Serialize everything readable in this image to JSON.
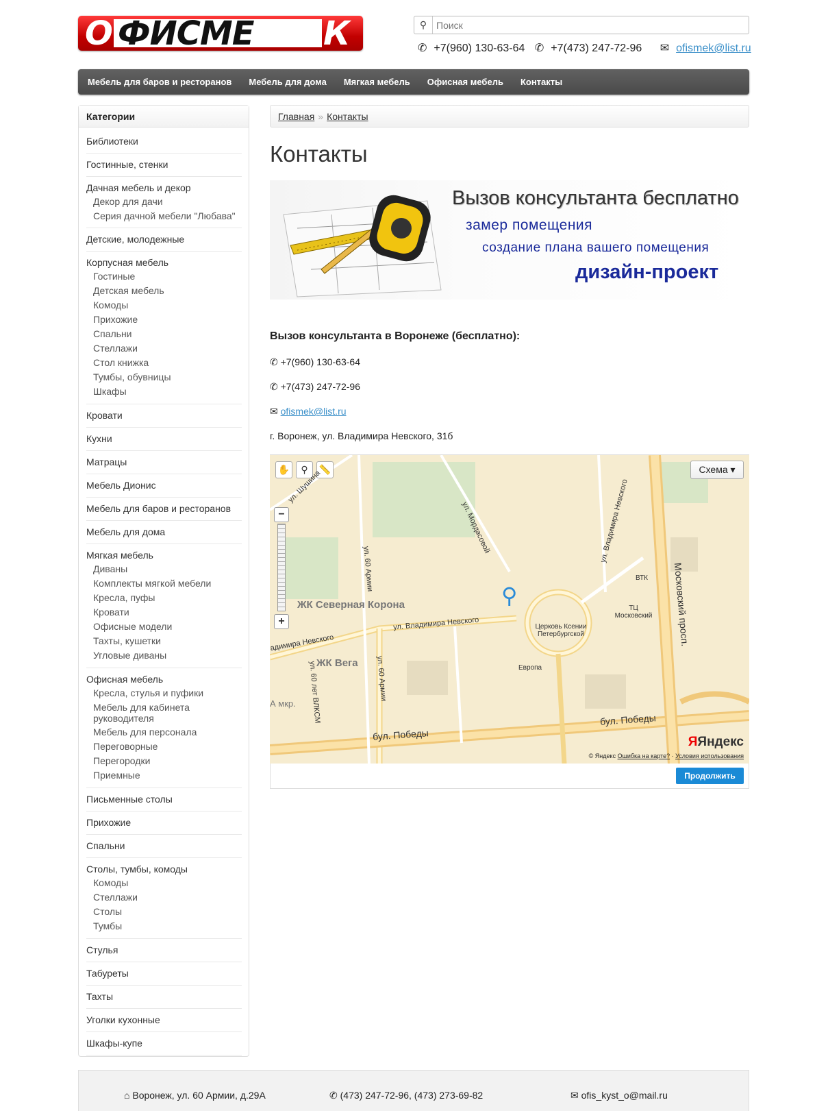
{
  "header": {
    "logo_text": "ОФИСМЕК",
    "search_placeholder": "Поиск",
    "phone1": "+7(960) 130-63-64",
    "phone2": "+7(473) 247-72-96",
    "email": "ofismek@list.ru"
  },
  "nav": {
    "items": [
      "Мебель для баров и ресторанов",
      "Мебель для дома",
      "Мягкая мебель",
      "Офисная мебель",
      "Контакты"
    ]
  },
  "sidebar": {
    "title": "Категории",
    "categories": [
      {
        "label": "Библиотеки",
        "sub": []
      },
      {
        "label": "Гостинные, стенки",
        "sub": []
      },
      {
        "label": "Дачная мебель и декор",
        "sub": [
          "Декор для дачи",
          "Серия дачной мебели \"Любава\""
        ]
      },
      {
        "label": "Детские, молодежные",
        "sub": []
      },
      {
        "label": "Корпусная мебель",
        "sub": [
          "Гостиные",
          "Детская мебель",
          "Комоды",
          "Прихожие",
          "Спальни",
          "Стеллажи",
          "Стол книжка",
          "Тумбы, обувницы",
          "Шкафы"
        ]
      },
      {
        "label": "Кровати",
        "sub": []
      },
      {
        "label": "Кухни",
        "sub": []
      },
      {
        "label": "Матрацы",
        "sub": []
      },
      {
        "label": "Мебель Дионис",
        "sub": []
      },
      {
        "label": "Мебель для баров и ресторанов",
        "sub": []
      },
      {
        "label": "Мебель для дома",
        "sub": []
      },
      {
        "label": "Мягкая мебель",
        "sub": [
          "Диваны",
          "Комплекты мягкой мебели",
          "Кресла, пуфы",
          "Кровати",
          "Офисные модели",
          "Тахты, кушетки",
          "Угловые диваны"
        ]
      },
      {
        "label": "Офисная мебель",
        "sub": [
          "Кресла, стулья и пуфики",
          "Мебель для кабинета руководителя",
          "Мебель для персонала",
          "Переговорные",
          "Перегородки",
          "Приемные"
        ]
      },
      {
        "label": "Письменные столы",
        "sub": []
      },
      {
        "label": "Прихожие",
        "sub": []
      },
      {
        "label": "Спальни",
        "sub": []
      },
      {
        "label": "Столы, тумбы, комоды",
        "sub": [
          "Комоды",
          "Стеллажи",
          "Столы",
          "Тумбы"
        ]
      },
      {
        "label": "Стулья",
        "sub": []
      },
      {
        "label": "Табуреты",
        "sub": []
      },
      {
        "label": "Тахты",
        "sub": []
      },
      {
        "label": "Уголки кухонные",
        "sub": []
      },
      {
        "label": "Шкафы-купе",
        "sub": []
      }
    ]
  },
  "breadcrumb": {
    "home": "Главная",
    "sep": "»",
    "current": "Контакты"
  },
  "page": {
    "title": "Контакты"
  },
  "banner": {
    "line1": "Вызов консультанта бесплатно",
    "line2": "замер помещения",
    "line3": "создание плана вашего помещения",
    "line4": "дизайн-проект"
  },
  "contacts": {
    "heading": "Вызов консультанта в Воронеже (бесплатно):",
    "phone1": "+7(960) 130-63-64",
    "phone2": "+7(473) 247-72-96",
    "email": "ofismek@list.ru",
    "address": "г. Воронеж, ул. Владимира Невского, 31б"
  },
  "map": {
    "schema_label": "Схема ▾",
    "labels": {
      "shushina": "ул. Шушина",
      "mordasovoy": "ул. Мордасовой",
      "nevskogo_v": "ул. Владимира Невского",
      "army60": "ул. 60 Армии",
      "army60b": "ул. 60 Армии",
      "severnaya": "ЖК Северная Корона",
      "nevskogo_h": "ул. Владимира Невского",
      "nevskogo_l": "адимира Невского",
      "vega": "ЖК Вега",
      "vlksm": "ул. 60 лет ВЛКСМ",
      "mkr": "А мкр.",
      "church": "Церковь Ксении Петербургской",
      "evropa": "Европа",
      "vtk": "ВТК",
      "tc": "ТЦ Московский",
      "moskovsky": "Московский просп.",
      "pobedy1": "бул. Победы",
      "pobedy2": "бул. Победы"
    },
    "copyright": "© Яндекс",
    "error_link": "Ошибка на карте?",
    "terms_link": "Условия использования",
    "brand": "Яндекс",
    "continue_button": "Продолжить"
  },
  "footer": {
    "address": "Воронеж, ул. 60 Армии, д.29А",
    "phones": "(473) 247-72-96, (473) 273-69-82",
    "email": "ofis_kyst_o@mail.ru"
  },
  "colors": {
    "nav_bg": "#555555",
    "link": "#3a8fc9",
    "logo_red": "#d40000",
    "button_blue": "#1a8ad6"
  }
}
